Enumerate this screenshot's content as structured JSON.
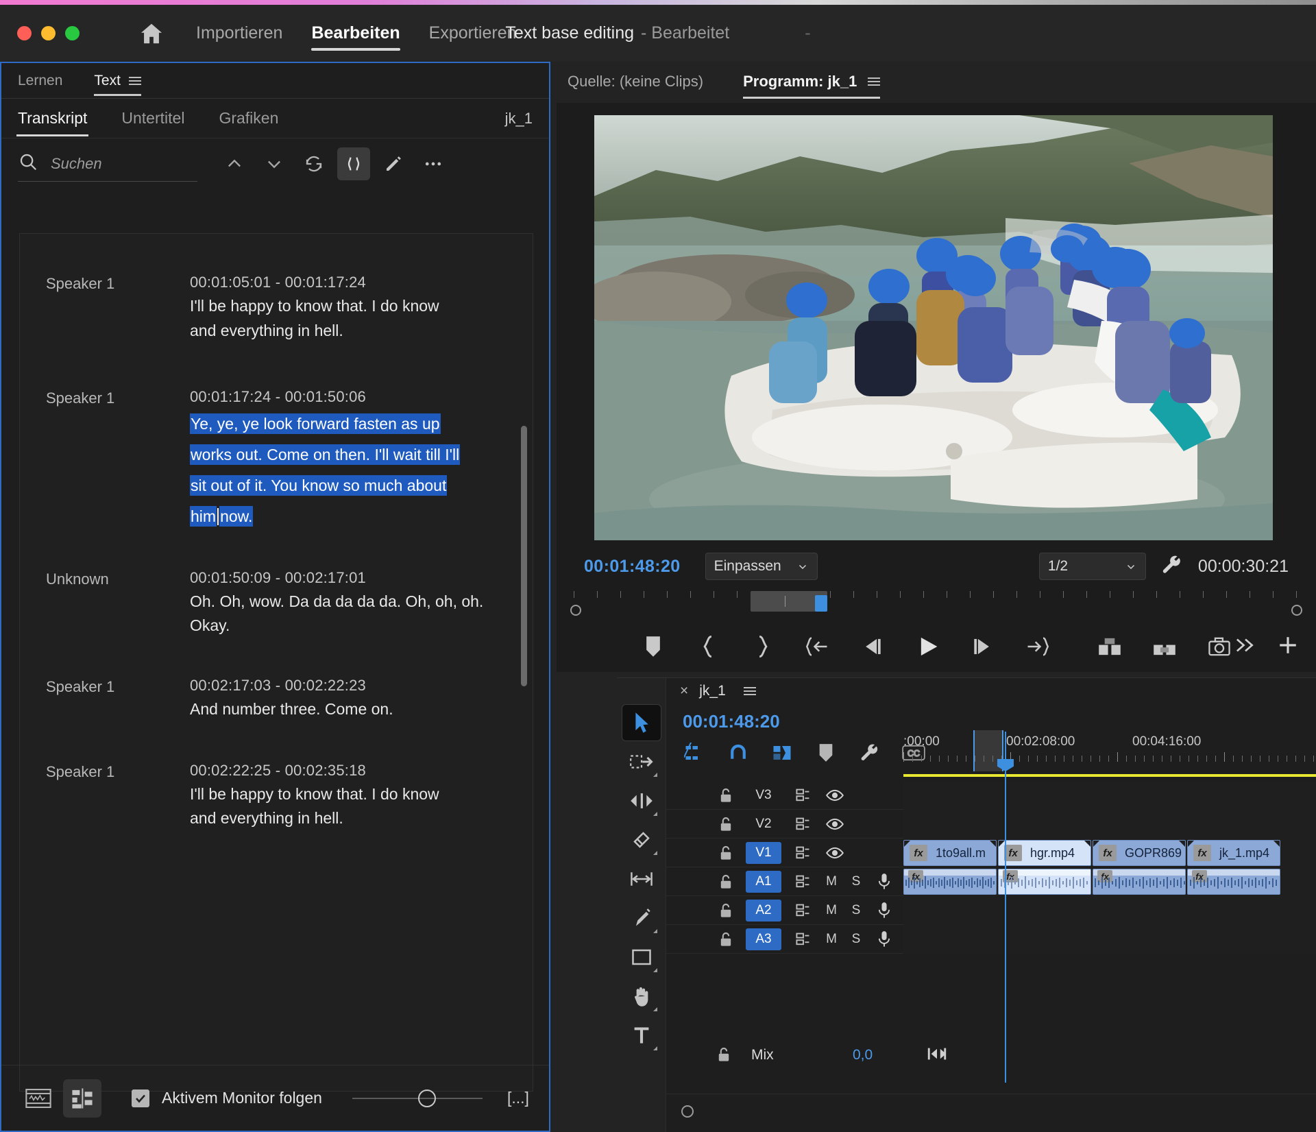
{
  "titlebar": {
    "home_icon": "home-icon",
    "nav": [
      {
        "label": "Importieren",
        "active": false
      },
      {
        "label": "Bearbeiten",
        "active": true
      },
      {
        "label": "Exportieren",
        "active": false
      }
    ],
    "project_name": "Text base editing",
    "project_state": "- Bearbeitet",
    "trailing_dash": "-"
  },
  "text_panel": {
    "panel_tabs": [
      {
        "label": "Lernen",
        "active": false
      },
      {
        "label": "Text",
        "active": true
      }
    ],
    "sub_tabs": [
      {
        "label": "Transkript",
        "active": true
      },
      {
        "label": "Untertitel",
        "active": false
      },
      {
        "label": "Grafiken",
        "active": false
      }
    ],
    "sequence_label": "jk_1",
    "search": {
      "placeholder": "Suchen",
      "value": "",
      "icon": "search-icon"
    },
    "toolbar_icons": [
      {
        "name": "chevron-up-icon",
        "active": false
      },
      {
        "name": "chevron-down-icon",
        "active": false
      },
      {
        "name": "refresh-icon",
        "active": false
      },
      {
        "name": "pause-gaps-icon",
        "active": true
      },
      {
        "name": "pencil-icon",
        "active": false
      },
      {
        "name": "more-options-icon",
        "active": false
      }
    ],
    "transcript": [
      {
        "speaker": "Speaker 1",
        "timecode": "00:01:05:01 - 00:01:17:24",
        "text": "I'll be happy to know that. I do know and everything in hell.",
        "highlighted": false
      },
      {
        "speaker": "Speaker 1",
        "timecode": "00:01:17:24 - 00:01:50:06",
        "text_before_caret": "Ye, ye, ye look forward fasten as up works out. Come on then. I'll wait till I'll sit out of it. You know so much about him",
        "text_after_caret": "now.",
        "highlighted": true
      },
      {
        "speaker": "Unknown",
        "timecode": "00:01:50:09 - 00:02:17:01",
        "text": "Oh. Oh, wow. Da da da da da. Oh, oh, oh. Okay.",
        "highlighted": false
      },
      {
        "speaker": "Speaker 1",
        "timecode": "00:02:17:03 - 00:02:22:23",
        "text": "And number three. Come on.",
        "highlighted": false
      },
      {
        "speaker": "Speaker 1",
        "timecode": "00:02:22:25 - 00:02:35:18",
        "text": "I'll be happy to know that. I do know and everything in hell.",
        "highlighted": false
      }
    ],
    "footer": {
      "left_icons": [
        {
          "name": "transcript-view-icon",
          "active": false
        },
        {
          "name": "list-view-icon",
          "active": true
        }
      ],
      "checkbox_label": "Aktivem Monitor folgen",
      "checkbox_checked": true,
      "more_button": "[...]"
    }
  },
  "monitor": {
    "tabs": [
      {
        "label": "Quelle: (keine Clips)",
        "active": false
      },
      {
        "label": "Programm: jk_1",
        "active": true
      }
    ],
    "menu_icon": "hamburger-icon",
    "playhead_timecode": "00:01:48:20",
    "fit_select": "Einpassen",
    "resolution_select": "1/2",
    "settings_icon": "wrench-icon",
    "duration": "00:00:30:21",
    "transport": [
      {
        "name": "add-marker-icon"
      },
      {
        "name": "mark-in-icon"
      },
      {
        "name": "mark-out-icon"
      },
      {
        "name": "go-to-in-icon"
      },
      {
        "name": "step-back-icon"
      },
      {
        "name": "play-icon"
      },
      {
        "name": "step-forward-icon"
      },
      {
        "name": "go-to-out-icon"
      },
      {
        "name": "lift-icon"
      },
      {
        "name": "extract-icon"
      },
      {
        "name": "export-frame-icon"
      }
    ],
    "overflow_icon": "chevrons-right-icon",
    "plus_icon": "plus-icon"
  },
  "timeline": {
    "close_icon": "close-icon",
    "sequence_name": "jk_1",
    "menu_icon": "hamburger-icon",
    "playhead_timecode": "00:01:48:20",
    "toggles": [
      {
        "name": "insert-overwrite-icon",
        "active": true
      },
      {
        "name": "snap-magnet-icon",
        "active": true
      },
      {
        "name": "linked-selection-icon",
        "active": true
      },
      {
        "name": "add-marker-icon",
        "active": false
      },
      {
        "name": "timeline-settings-wrench-icon",
        "active": false
      },
      {
        "name": "closed-captions-icon",
        "active": false
      }
    ],
    "tools": [
      {
        "name": "selection-tool-icon",
        "active": true
      },
      {
        "name": "track-select-forward-tool-icon",
        "active": false
      },
      {
        "name": "ripple-edit-tool-icon",
        "active": false
      },
      {
        "name": "rolling-edit-tool-icon",
        "active": false
      },
      {
        "name": "rate-stretch-tool-icon",
        "active": false
      },
      {
        "name": "pen-tool-icon",
        "active": false
      },
      {
        "name": "rectangle-tool-icon",
        "active": false
      },
      {
        "name": "hand-tool-icon",
        "active": false
      },
      {
        "name": "type-tool-icon",
        "active": false
      }
    ],
    "ruler_labels": [
      ":00:00",
      "00:02:08:00",
      "00:04:16:00"
    ],
    "tracks": [
      {
        "name": "V3",
        "type": "video",
        "selected": false,
        "clips": []
      },
      {
        "name": "V2",
        "type": "video",
        "selected": false,
        "clips": []
      },
      {
        "name": "V1",
        "type": "video",
        "selected": true,
        "clips": [
          {
            "label": "1to9all.m",
            "light": false
          },
          {
            "label": "hgr.mp4",
            "light": true
          },
          {
            "label": "GOPR869",
            "light": false
          },
          {
            "label": "jk_1.mp4",
            "light": false
          }
        ]
      },
      {
        "name": "A1",
        "type": "audio",
        "selected": true,
        "mute": "M",
        "solo": "S",
        "clips": 4
      },
      {
        "name": "A2",
        "type": "audio",
        "selected": true,
        "mute": "M",
        "solo": "S",
        "clips": 0
      },
      {
        "name": "A3",
        "type": "audio",
        "selected": true,
        "mute": "M",
        "solo": "S",
        "clips": 0
      }
    ],
    "mix_label": "Mix",
    "mix_value": "0,0",
    "mix_icon": "mix-meter-icon"
  },
  "colors": {
    "accent_blue": "#2d6bc4",
    "timecode_blue": "#4d9aeb",
    "highlight_blue": "#1f5bbf",
    "yellow_bar": "#e8e832",
    "clip_blue": "#8ba8d6"
  }
}
